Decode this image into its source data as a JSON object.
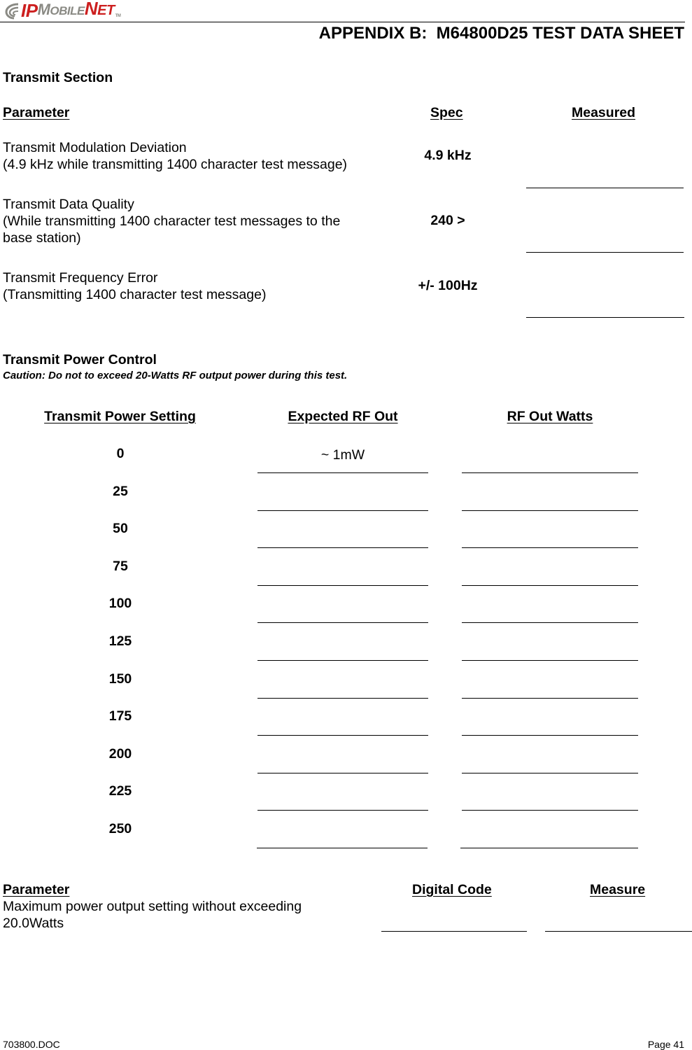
{
  "header": {
    "logo": {
      "ip": "IP",
      "mobile_m": "M",
      "mobile_rest": "OBILE",
      "net_n": "N",
      "net_rest": "ET",
      "tm": "TM"
    },
    "title": "APPENDIX B:  M64800D25 TEST DATA SHEET"
  },
  "colors": {
    "logo_red": "#cc1f1f",
    "logo_gray": "#8a8a84",
    "text": "#000000"
  },
  "transmit_section": {
    "title": "Transmit Section",
    "columns": {
      "parameter": "Parameter",
      "spec": "Spec",
      "measured": "Measured"
    },
    "rows": [
      {
        "line1": "Transmit Modulation Deviation",
        "line2": "(4.9 kHz while transmitting 1400 character test message)",
        "line3": "",
        "spec": "4.9 kHz",
        "measured": ""
      },
      {
        "line1": "Transmit Data Quality",
        "line2": "(While transmitting 1400 character test messages to the",
        "line3": "base station)",
        "spec": "240 >",
        "measured": ""
      },
      {
        "line1": "Transmit Frequency Error",
        "line2": "(Transmitting 1400 character test message)",
        "line3": "",
        "spec": "+/- 100Hz",
        "measured": ""
      }
    ]
  },
  "power_control": {
    "title": "Transmit Power Control",
    "caution": "Caution: Do not to exceed 20-Watts RF output power during this test.",
    "columns": {
      "setting": "Transmit Power Setting",
      "expected": "Expected RF Out",
      "watts": "RF Out Watts"
    },
    "rows": [
      {
        "setting": "0",
        "expected": "~ 1mW",
        "watts": ""
      },
      {
        "setting": "25",
        "expected": "",
        "watts": ""
      },
      {
        "setting": "50",
        "expected": "",
        "watts": ""
      },
      {
        "setting": "75",
        "expected": "",
        "watts": ""
      },
      {
        "setting": "100",
        "expected": "",
        "watts": ""
      },
      {
        "setting": "125",
        "expected": "",
        "watts": ""
      },
      {
        "setting": "150",
        "expected": "",
        "watts": ""
      },
      {
        "setting": "175",
        "expected": "",
        "watts": ""
      },
      {
        "setting": "200",
        "expected": "",
        "watts": ""
      },
      {
        "setting": "225",
        "expected": "",
        "watts": ""
      },
      {
        "setting": "250",
        "expected": "",
        "watts": ""
      }
    ]
  },
  "max_power": {
    "columns": {
      "parameter": "Parameter",
      "digital_code": "Digital Code",
      "measure": "Measure"
    },
    "line1": "Maximum power output setting without exceeding",
    "line2": "20.0Watts",
    "digital_code": "",
    "measure": ""
  },
  "footer": {
    "doc": "703800.DOC",
    "page": "Page 41"
  }
}
